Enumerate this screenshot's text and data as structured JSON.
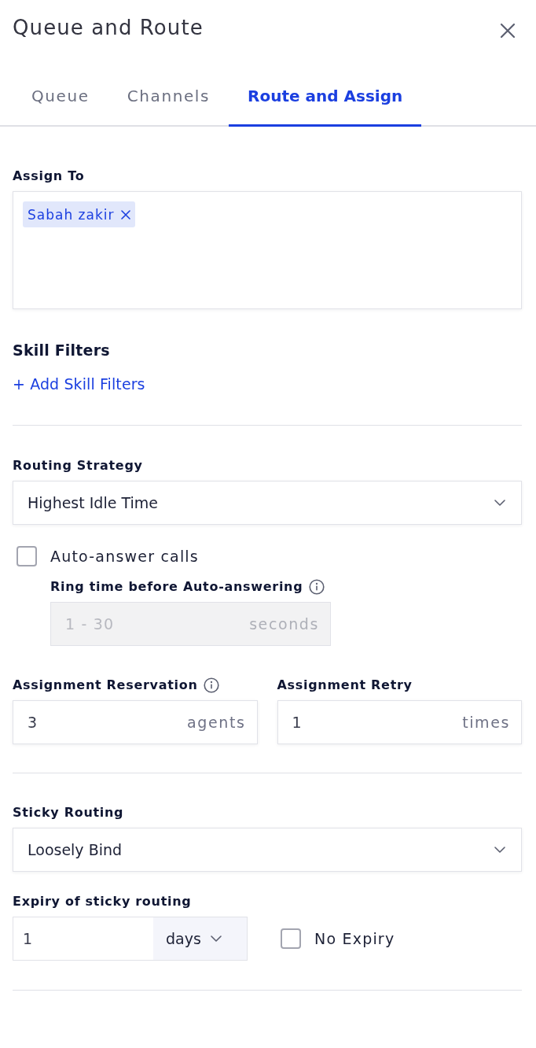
{
  "header": {
    "title": "Queue and Route"
  },
  "tabs": [
    {
      "label": "Queue",
      "selected": false
    },
    {
      "label": "Channels",
      "selected": false
    },
    {
      "label": "Route and Assign",
      "selected": true
    }
  ],
  "assign_to": {
    "label": "Assign To",
    "chips": [
      {
        "label": "Sabah zakir"
      }
    ]
  },
  "skill_filters": {
    "title": "Skill Filters",
    "add_link": "+ Add Skill Filters"
  },
  "routing_strategy": {
    "label": "Routing Strategy",
    "value": "Highest Idle Time"
  },
  "auto_answer": {
    "label": "Auto-answer calls",
    "checked": false
  },
  "ring_time": {
    "label": "Ring time before Auto-answering",
    "info_icon": true,
    "placeholder": "1 - 30",
    "unit": "seconds",
    "disabled": true
  },
  "assignment": [
    {
      "label": "Assignment Reservation",
      "info_icon": true,
      "value": "3",
      "unit": "agents"
    },
    {
      "label": "Assignment Retry",
      "info_icon": false,
      "value": "1",
      "unit": "times"
    }
  ],
  "sticky_routing": {
    "label": "Sticky Routing",
    "value": "Loosely Bind"
  },
  "expiry": {
    "label": "Expiry of sticky routing",
    "value": "1",
    "unit": "days"
  },
  "no_expiry": {
    "label": "No Expiry",
    "checked": false
  }
}
